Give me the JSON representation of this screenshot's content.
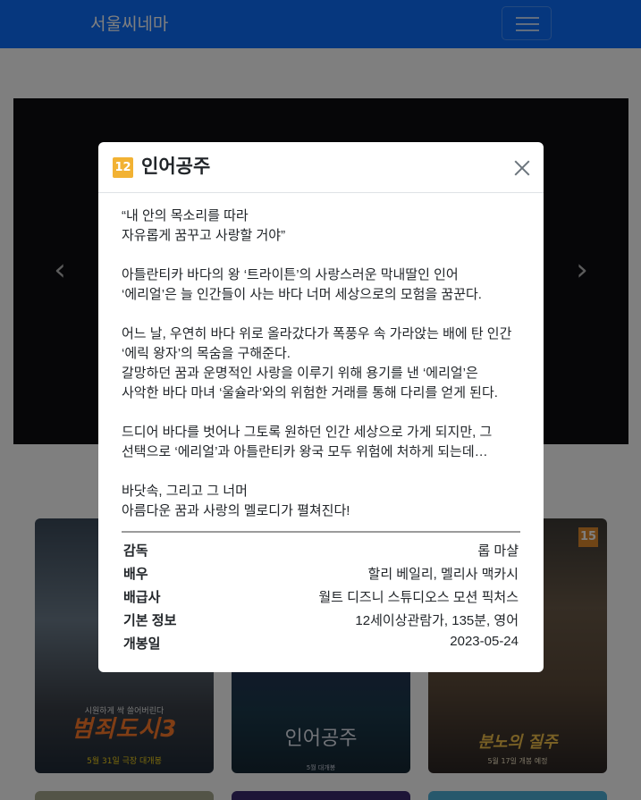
{
  "navbar": {
    "brand": "서울씨네마"
  },
  "carousel": {
    "prev_glyph": "‹",
    "next_glyph": "›"
  },
  "posters": [
    {
      "title": "범죄도시3",
      "tagline": "시원하게 싹 쓸어버린다",
      "date": "5월 31일 극장 대개봉"
    },
    {
      "title": "인어공주",
      "date": "5월 대개봉"
    },
    {
      "title": "분노의 질주",
      "date": "5월 17일 개봉 예정"
    }
  ],
  "poster_badge": "15",
  "modal": {
    "rating": "12",
    "title": "인어공주",
    "synopsis": [
      "“내 안의 목소리를 따라",
      "자유롭게 꿈꾸고 사랑할 거야”",
      "",
      "아틀란티카 바다의 왕 ‘트라이튼’의 사랑스러운 막내딸인 인어",
      "‘에리얼’은 늘 인간들이 사는 바다 너머 세상으로의 모험을 꿈꾼다.",
      "",
      "어느 날, 우연히 바다 위로 올라갔다가 폭풍우 속 가라앉는 배에 탄 인간",
      "‘에릭 왕자’의 목숨을 구해준다.",
      "갈망하던 꿈과 운명적인 사랑을 이루기 위해 용기를 낸 ‘에리얼’은",
      "사악한 바다 마녀 ‘울슐라’와의 위험한 거래를 통해 다리를 얻게 된다.",
      "",
      "드디어 바다를 벗어나 그토록 원하던 인간 세상으로 가게 되지만, 그",
      "선택으로 ‘에리얼’과 아틀란티카 왕국 모두 위험에 처하게 되는데…",
      "",
      "바닷속, 그리고 그 너머",
      "아름다운 꿈과 사랑의 멜로디가 펼쳐진다!"
    ],
    "info": [
      {
        "label": "감독",
        "value": "롭 마샬"
      },
      {
        "label": "배우",
        "value": "할리 베일리, 멜리사 맥카시"
      },
      {
        "label": "배급사",
        "value": "월트 디즈니 스튜디오스 모션 픽처스"
      },
      {
        "label": "기본 정보",
        "value": "12세이상관람가, 135분, 영어"
      },
      {
        "label": "개봉일",
        "value": "2023-05-24"
      }
    ]
  },
  "colors": {
    "navbar": "#0d6efd",
    "rating_badge": "#f2b233",
    "badge15": "#e08a2c"
  }
}
